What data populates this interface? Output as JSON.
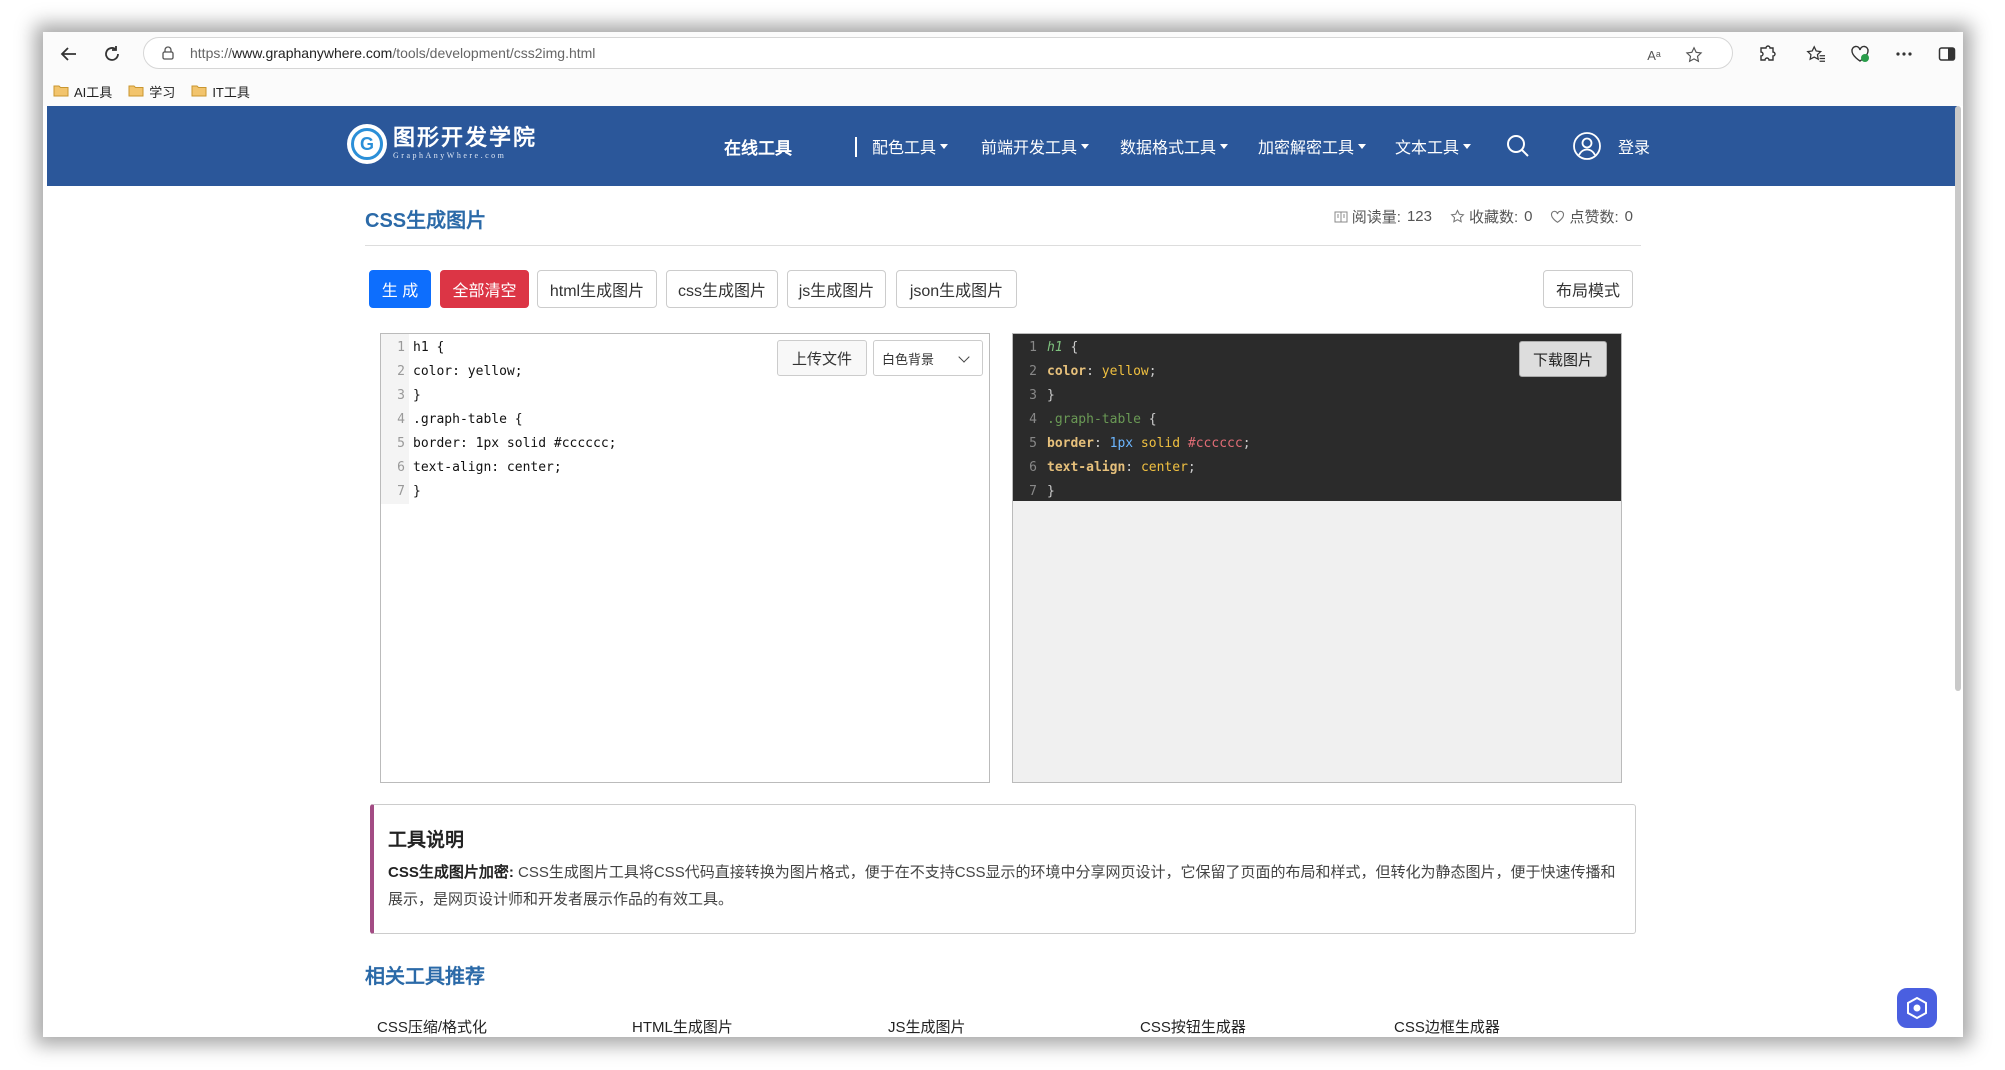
{
  "browser": {
    "url_prefix": "https://",
    "url_domain": "www.graphanywhere.com",
    "url_path": "/tools/development/css2img.html",
    "read_aloud_label": "Aᵃ",
    "bookmarks": [
      {
        "label": "AI工具"
      },
      {
        "label": "学习"
      },
      {
        "label": "IT工具"
      }
    ]
  },
  "site": {
    "logo_cn": "图形开发学院",
    "logo_en": "GraphAnyWhere.com",
    "nav_online": "在线工具",
    "nav_items": [
      {
        "label": "配色工具"
      },
      {
        "label": "前端开发工具"
      },
      {
        "label": "数据格式工具"
      },
      {
        "label": "加密解密工具"
      },
      {
        "label": "文本工具"
      }
    ],
    "login_label": "登录",
    "header_color": "#2b579a"
  },
  "page": {
    "title": "CSS生成图片",
    "stats": {
      "views_label": "阅读量:",
      "views_value": "123",
      "favs_label": "收藏数:",
      "favs_value": "0",
      "likes_label": "点赞数:",
      "likes_value": "0"
    },
    "toolbar": {
      "generate": "生 成",
      "clear_all": "全部清空",
      "tab_html": "html生成图片",
      "tab_css": "css生成图片",
      "tab_js": "js生成图片",
      "tab_json": "json生成图片",
      "layout_mode": "布局模式"
    },
    "editor": {
      "upload_label": "上传文件",
      "background_selected": "白色背景",
      "lines": [
        {
          "n": "1",
          "text": "h1 {"
        },
        {
          "n": "2",
          "text": "color: yellow;"
        },
        {
          "n": "3",
          "text": "}"
        },
        {
          "n": "4",
          "text": ".graph-table {"
        },
        {
          "n": "5",
          "text": "border: 1px solid #cccccc;"
        },
        {
          "n": "6",
          "text": "text-align: center;"
        },
        {
          "n": "7",
          "text": "}"
        }
      ]
    },
    "preview": {
      "download_label": "下载图片",
      "line_numbers": [
        "1",
        "2",
        "3",
        "4",
        "5",
        "6",
        "7"
      ],
      "tokens": {
        "l1_sel": "h1",
        "l1_brace": " {",
        "l2_prop": "color",
        "l2_colon": ": ",
        "l2_val": "yellow",
        "l2_semi": ";",
        "l3": "}",
        "l4_sel": ".graph-table",
        "l4_brace": " {",
        "l5_prop": "border",
        "l5_colon": ": ",
        "l5_num": "1px",
        "l5_solid": " solid ",
        "l5_hex": "#cccccc",
        "l5_semi": ";",
        "l6_prop": "text-align",
        "l6_colon": ": ",
        "l6_val": "center",
        "l6_semi": ";",
        "l7": "}"
      }
    },
    "description": {
      "heading": "工具说明",
      "lead": "CSS生成图片加密:",
      "body": " CSS生成图片工具将CSS代码直接转换为图片格式，便于在不支持CSS显示的环境中分享网页设计，它保留了页面的布局和样式，但转化为静态图片，便于快速传播和展示，是网页设计师和开发者展示作品的有效工具。"
    },
    "related": {
      "title": "相关工具推荐",
      "items": [
        {
          "label": "CSS压缩/格式化"
        },
        {
          "label": "HTML生成图片"
        },
        {
          "label": "JS生成图片"
        },
        {
          "label": "CSS按钮生成器"
        },
        {
          "label": "CSS边框生成器"
        }
      ]
    }
  }
}
